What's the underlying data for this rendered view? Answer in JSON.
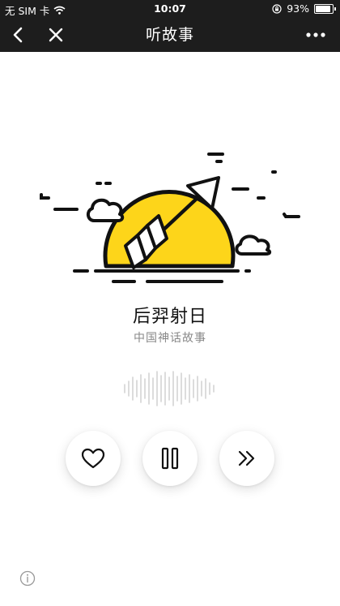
{
  "status_bar": {
    "carrier": "无 SIM 卡",
    "time": "10:07",
    "battery": "93%",
    "battery_level": 0.93
  },
  "nav": {
    "title": "听故事",
    "back_icon": "chevron-left-icon",
    "close_icon": "close-icon",
    "more_icon": "more-dots-icon"
  },
  "story": {
    "title": "后羿射日",
    "subtitle": "中国神话故事"
  },
  "controls": {
    "like_icon": "heart-icon",
    "pause_icon": "pause-icon",
    "next_icon": "fast-forward-icon"
  },
  "info_icon": "info-icon",
  "colors": {
    "nav_background": "#1d1d1d",
    "sun": "#FDD51A",
    "outline": "#111111",
    "subtitle": "#888888"
  }
}
